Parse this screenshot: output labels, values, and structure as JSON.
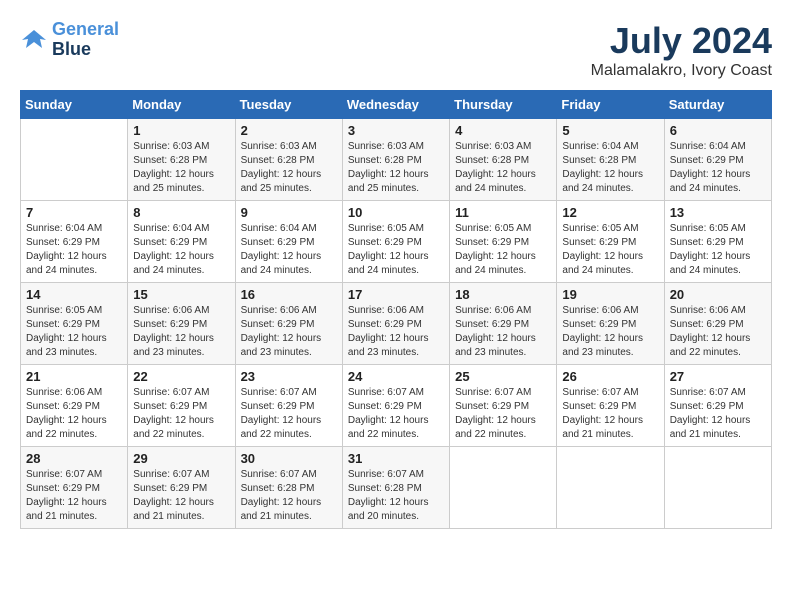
{
  "logo": {
    "line1": "General",
    "line2": "Blue"
  },
  "title": "July 2024",
  "location": "Malamalakro, Ivory Coast",
  "days_of_week": [
    "Sunday",
    "Monday",
    "Tuesday",
    "Wednesday",
    "Thursday",
    "Friday",
    "Saturday"
  ],
  "weeks": [
    [
      {
        "day": "",
        "info": ""
      },
      {
        "day": "1",
        "info": "Sunrise: 6:03 AM\nSunset: 6:28 PM\nDaylight: 12 hours\nand 25 minutes."
      },
      {
        "day": "2",
        "info": "Sunrise: 6:03 AM\nSunset: 6:28 PM\nDaylight: 12 hours\nand 25 minutes."
      },
      {
        "day": "3",
        "info": "Sunrise: 6:03 AM\nSunset: 6:28 PM\nDaylight: 12 hours\nand 25 minutes."
      },
      {
        "day": "4",
        "info": "Sunrise: 6:03 AM\nSunset: 6:28 PM\nDaylight: 12 hours\nand 24 minutes."
      },
      {
        "day": "5",
        "info": "Sunrise: 6:04 AM\nSunset: 6:28 PM\nDaylight: 12 hours\nand 24 minutes."
      },
      {
        "day": "6",
        "info": "Sunrise: 6:04 AM\nSunset: 6:29 PM\nDaylight: 12 hours\nand 24 minutes."
      }
    ],
    [
      {
        "day": "7",
        "info": "Sunrise: 6:04 AM\nSunset: 6:29 PM\nDaylight: 12 hours\nand 24 minutes."
      },
      {
        "day": "8",
        "info": "Sunrise: 6:04 AM\nSunset: 6:29 PM\nDaylight: 12 hours\nand 24 minutes."
      },
      {
        "day": "9",
        "info": "Sunrise: 6:04 AM\nSunset: 6:29 PM\nDaylight: 12 hours\nand 24 minutes."
      },
      {
        "day": "10",
        "info": "Sunrise: 6:05 AM\nSunset: 6:29 PM\nDaylight: 12 hours\nand 24 minutes."
      },
      {
        "day": "11",
        "info": "Sunrise: 6:05 AM\nSunset: 6:29 PM\nDaylight: 12 hours\nand 24 minutes."
      },
      {
        "day": "12",
        "info": "Sunrise: 6:05 AM\nSunset: 6:29 PM\nDaylight: 12 hours\nand 24 minutes."
      },
      {
        "day": "13",
        "info": "Sunrise: 6:05 AM\nSunset: 6:29 PM\nDaylight: 12 hours\nand 24 minutes."
      }
    ],
    [
      {
        "day": "14",
        "info": "Sunrise: 6:05 AM\nSunset: 6:29 PM\nDaylight: 12 hours\nand 23 minutes."
      },
      {
        "day": "15",
        "info": "Sunrise: 6:06 AM\nSunset: 6:29 PM\nDaylight: 12 hours\nand 23 minutes."
      },
      {
        "day": "16",
        "info": "Sunrise: 6:06 AM\nSunset: 6:29 PM\nDaylight: 12 hours\nand 23 minutes."
      },
      {
        "day": "17",
        "info": "Sunrise: 6:06 AM\nSunset: 6:29 PM\nDaylight: 12 hours\nand 23 minutes."
      },
      {
        "day": "18",
        "info": "Sunrise: 6:06 AM\nSunset: 6:29 PM\nDaylight: 12 hours\nand 23 minutes."
      },
      {
        "day": "19",
        "info": "Sunrise: 6:06 AM\nSunset: 6:29 PM\nDaylight: 12 hours\nand 23 minutes."
      },
      {
        "day": "20",
        "info": "Sunrise: 6:06 AM\nSunset: 6:29 PM\nDaylight: 12 hours\nand 22 minutes."
      }
    ],
    [
      {
        "day": "21",
        "info": "Sunrise: 6:06 AM\nSunset: 6:29 PM\nDaylight: 12 hours\nand 22 minutes."
      },
      {
        "day": "22",
        "info": "Sunrise: 6:07 AM\nSunset: 6:29 PM\nDaylight: 12 hours\nand 22 minutes."
      },
      {
        "day": "23",
        "info": "Sunrise: 6:07 AM\nSunset: 6:29 PM\nDaylight: 12 hours\nand 22 minutes."
      },
      {
        "day": "24",
        "info": "Sunrise: 6:07 AM\nSunset: 6:29 PM\nDaylight: 12 hours\nand 22 minutes."
      },
      {
        "day": "25",
        "info": "Sunrise: 6:07 AM\nSunset: 6:29 PM\nDaylight: 12 hours\nand 22 minutes."
      },
      {
        "day": "26",
        "info": "Sunrise: 6:07 AM\nSunset: 6:29 PM\nDaylight: 12 hours\nand 21 minutes."
      },
      {
        "day": "27",
        "info": "Sunrise: 6:07 AM\nSunset: 6:29 PM\nDaylight: 12 hours\nand 21 minutes."
      }
    ],
    [
      {
        "day": "28",
        "info": "Sunrise: 6:07 AM\nSunset: 6:29 PM\nDaylight: 12 hours\nand 21 minutes."
      },
      {
        "day": "29",
        "info": "Sunrise: 6:07 AM\nSunset: 6:29 PM\nDaylight: 12 hours\nand 21 minutes."
      },
      {
        "day": "30",
        "info": "Sunrise: 6:07 AM\nSunset: 6:28 PM\nDaylight: 12 hours\nand 21 minutes."
      },
      {
        "day": "31",
        "info": "Sunrise: 6:07 AM\nSunset: 6:28 PM\nDaylight: 12 hours\nand 20 minutes."
      },
      {
        "day": "",
        "info": ""
      },
      {
        "day": "",
        "info": ""
      },
      {
        "day": "",
        "info": ""
      }
    ]
  ]
}
